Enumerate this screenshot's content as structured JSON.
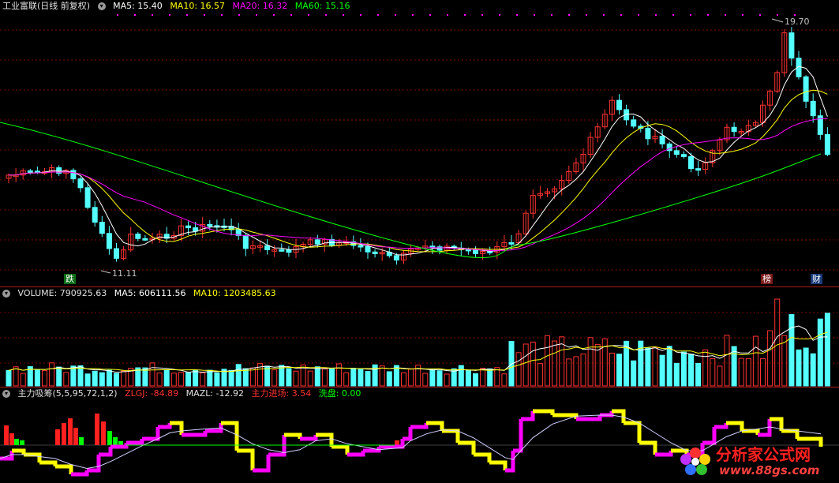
{
  "main": {
    "title": "工业富联(日线 前复权)",
    "ma5": "MA5: 15.40",
    "ma10": "MA10: 16.57",
    "ma20": "MA20: 16.32",
    "ma60": "MA60: 15.16",
    "high_label": "19.70",
    "low_label": "11.11",
    "tag_left": "跌",
    "tag_mid": "榜",
    "tag_right": "财"
  },
  "volume": {
    "label": "VOLUME: 790925.63",
    "ma5": "MA5: 606111.56",
    "ma10": "MA10: 1203485.63"
  },
  "indicator": {
    "label": "主力吸筹(5,5,95,72,1,2)",
    "zlgj": "ZLGJ: -84.89",
    "mazl": "MAZL: -12.92",
    "inflow": "主力进场: 3.54",
    "washout": "洗盘: 0.00"
  },
  "watermark": {
    "name": "分析家公式网",
    "url": "www.88gs.com"
  },
  "colors": {
    "up": "#ff3232",
    "down": "#54ffff",
    "ma5": "#ffffff",
    "ma10": "#ffff00",
    "ma20": "#ff00ff",
    "ma60": "#00ff00",
    "grid": "#7a0000"
  }
}
